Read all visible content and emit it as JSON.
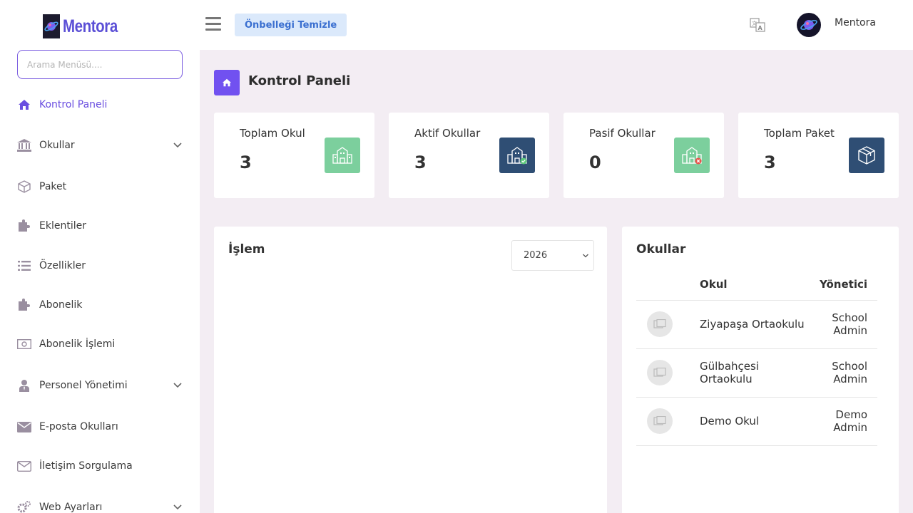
{
  "app": {
    "brand": "Mentora",
    "username": "Mentora"
  },
  "sidebar": {
    "search_placeholder": "Arama Menüsü....",
    "items": [
      {
        "label": "Kontrol Paneli",
        "icon": "home-icon",
        "active": true
      },
      {
        "label": "Okullar",
        "icon": "bank-icon",
        "expandable": true
      },
      {
        "label": "Paket",
        "icon": "package-icon"
      },
      {
        "label": "Eklentiler",
        "icon": "puzzle-icon"
      },
      {
        "label": "Özellikler",
        "icon": "list-icon"
      },
      {
        "label": "Abonelik",
        "icon": "puzzle-icon"
      },
      {
        "label": "Abonelik İşlemi",
        "icon": "money-icon"
      },
      {
        "label": "Personel Yönetimi",
        "icon": "user-tie-icon",
        "expandable": true
      },
      {
        "label": "E-posta Okulları",
        "icon": "envelope-icon"
      },
      {
        "label": "İletişim Sorgulama",
        "icon": "envelope-outline-icon"
      },
      {
        "label": "Web Ayarları",
        "icon": "gears-icon",
        "expandable": true
      }
    ]
  },
  "topbar": {
    "cache_button": "Önbelleği Temizle"
  },
  "page": {
    "title": "Kontrol Paneli"
  },
  "stats": [
    {
      "label": "Toplam Okul",
      "value": "3",
      "color": "#7ccf9d"
    },
    {
      "label": "Aktif Okullar",
      "value": "3",
      "color": "#2f4e74"
    },
    {
      "label": "Pasif Okullar",
      "value": "0",
      "color": "#7ccf9d"
    },
    {
      "label": "Toplam Paket",
      "value": "3",
      "color": "#2f4e74"
    }
  ],
  "transactions_panel": {
    "title": "İşlem",
    "year": "2026"
  },
  "schools_panel": {
    "title": "Okullar",
    "headers": {
      "school": "Okul",
      "admin": "Yönetici"
    },
    "rows": [
      {
        "school": "Ziyapaşa Ortaokulu",
        "admin": "School Admin"
      },
      {
        "school": "Gülbahçesi Ortaokulu",
        "admin": "School Admin"
      },
      {
        "school": "Demo Okul",
        "admin": "Demo Admin"
      }
    ]
  },
  "colors": {
    "accent": "#7151f0",
    "active_text": "#6a4ee0",
    "background": "#f3edf3"
  }
}
